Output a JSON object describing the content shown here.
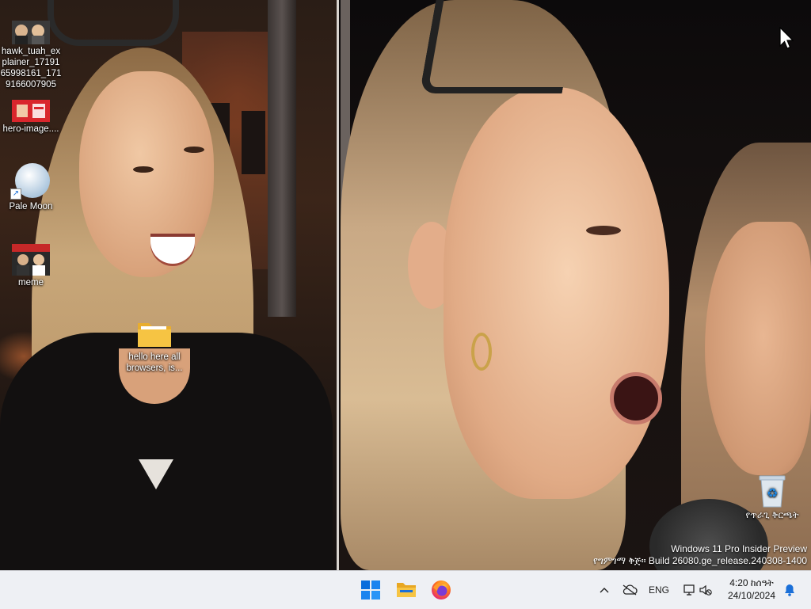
{
  "desktop": {
    "icons": [
      {
        "label": "hawk_tuah_explainer_1719165998161_1719166007905",
        "label_lines": [
          "hawk_tuah_ex",
          "plainer_17191",
          "65998161_171",
          "9166007905"
        ],
        "icon": "image-file-icon"
      },
      {
        "label": "hero-image....",
        "icon": "image-file-icon"
      },
      {
        "label": "Pale Moon",
        "icon": "pale-moon-browser-icon"
      },
      {
        "label": "meme",
        "icon": "image-file-icon"
      },
      {
        "label_lines": [
          "hello here all",
          "browsers, is..."
        ],
        "icon": "folder-icon"
      },
      {
        "label": "የጥራጊ ቅርጫት",
        "icon": "recycle-bin-icon"
      }
    ]
  },
  "watermark": {
    "line1": "Windows 11 Pro Insider Preview",
    "line2": "የግምገማ ቅጅ። Build 26080.ge_release.240308-1400"
  },
  "taskbar": {
    "pinned": [
      {
        "name": "Start",
        "icon": "windows-start-icon"
      },
      {
        "name": "File Explorer",
        "icon": "file-explorer-icon"
      },
      {
        "name": "Firefox",
        "icon": "firefox-icon"
      }
    ],
    "tray": {
      "language": "ENG",
      "time": "4:20 ከሰዓት",
      "date": "24/10/2024"
    }
  },
  "colors": {
    "taskbar_bg": "#eef0f4",
    "start_blue": "#0a6ddc",
    "folder_yellow": "#f6c443",
    "notification_blue": "#1a6fd8"
  }
}
